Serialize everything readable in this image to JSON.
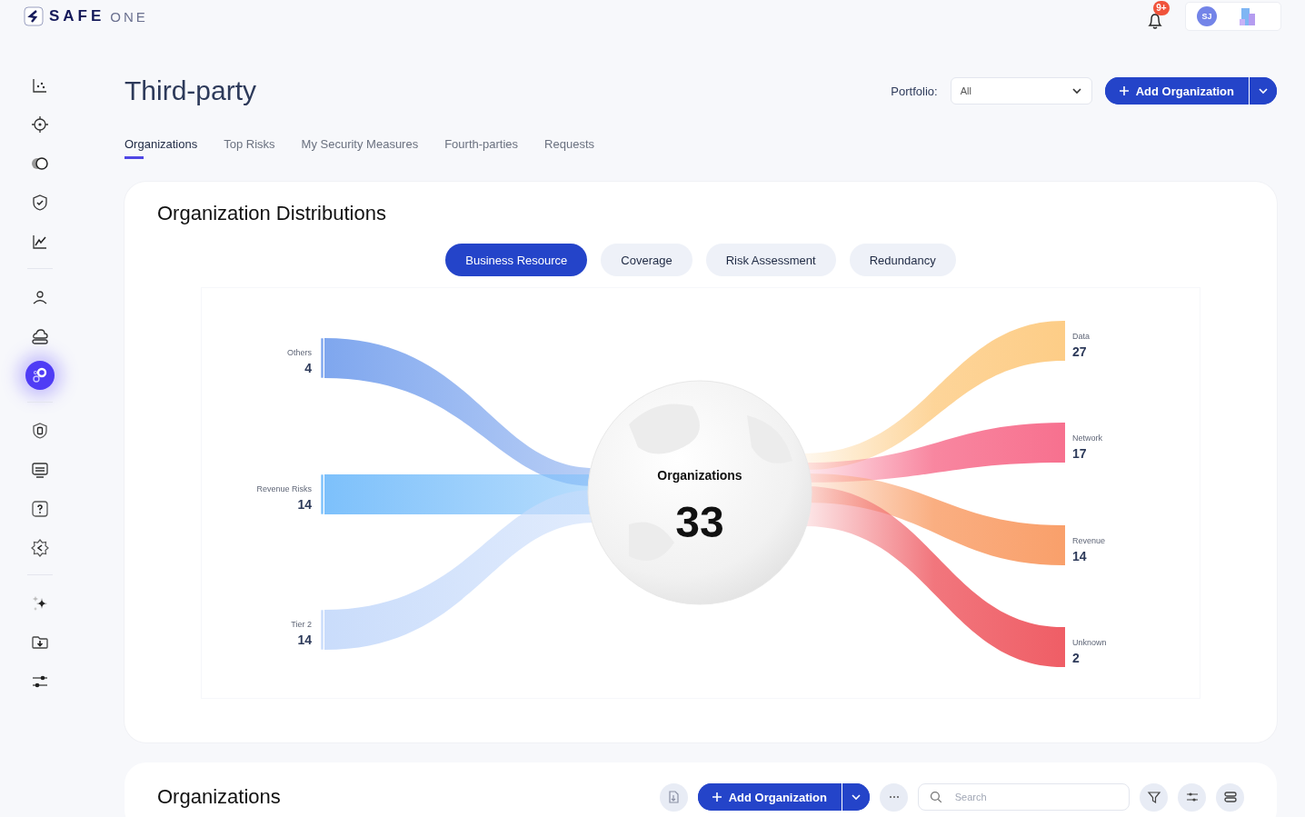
{
  "logo": {
    "brand": "SAFE",
    "suffix": "ONE"
  },
  "header": {
    "notification_badge": "9+",
    "avatar_initials": "SJ"
  },
  "sidebar": {
    "groups": [
      [
        {
          "selected": false
        },
        {
          "selected": false
        },
        {
          "selected": false
        },
        {
          "selected": false
        },
        {
          "selected": false
        }
      ],
      [
        {
          "selected": false
        },
        {
          "selected": false
        },
        {
          "selected": true
        }
      ],
      [
        {
          "selected": false
        },
        {
          "selected": false
        },
        {
          "selected": false
        },
        {
          "selected": false
        }
      ],
      [
        {
          "selected": false
        },
        {
          "selected": false
        },
        {
          "selected": false
        }
      ]
    ]
  },
  "page": {
    "title": "Third-party",
    "portfolio_label": "Portfolio:",
    "portfolio_value": "All",
    "add_button": "Add Organization"
  },
  "tabs": [
    {
      "label": "Organizations",
      "selected": true
    },
    {
      "label": "Top Risks",
      "selected": false
    },
    {
      "label": "My Security Measures",
      "selected": false
    },
    {
      "label": "Fourth-parties",
      "selected": false
    },
    {
      "label": "Requests",
      "selected": false
    }
  ],
  "distributions": {
    "title": "Organization Distributions",
    "segments": [
      {
        "label": "Business Resource",
        "selected": true
      },
      {
        "label": "Coverage",
        "selected": false
      },
      {
        "label": "Risk Assessment",
        "selected": false
      },
      {
        "label": "Redundancy",
        "selected": false
      }
    ],
    "flow": {
      "center_label": "Organizations",
      "total": "33",
      "sources": [
        {
          "label": "Others",
          "value": "4",
          "color": "#7ea6ee"
        },
        {
          "label": "Revenue Risks",
          "value": "14",
          "color": "#7cc0fb"
        },
        {
          "label": "Tier 2",
          "value": "14",
          "color": "#c9dcfb"
        }
      ],
      "targets": [
        {
          "label": "Data",
          "value": "27",
          "color": "#fdcd87"
        },
        {
          "label": "Network",
          "value": "17",
          "color": "#f7718f"
        },
        {
          "label": "Revenue",
          "value": "14",
          "color": "#f9a06b"
        },
        {
          "label": "Unknown",
          "value": "2",
          "color": "#ef5e66"
        }
      ]
    }
  },
  "organizations": {
    "title": "Organizations",
    "add_button": "Add Organization",
    "search": {
      "placeholder": "Search"
    }
  }
}
